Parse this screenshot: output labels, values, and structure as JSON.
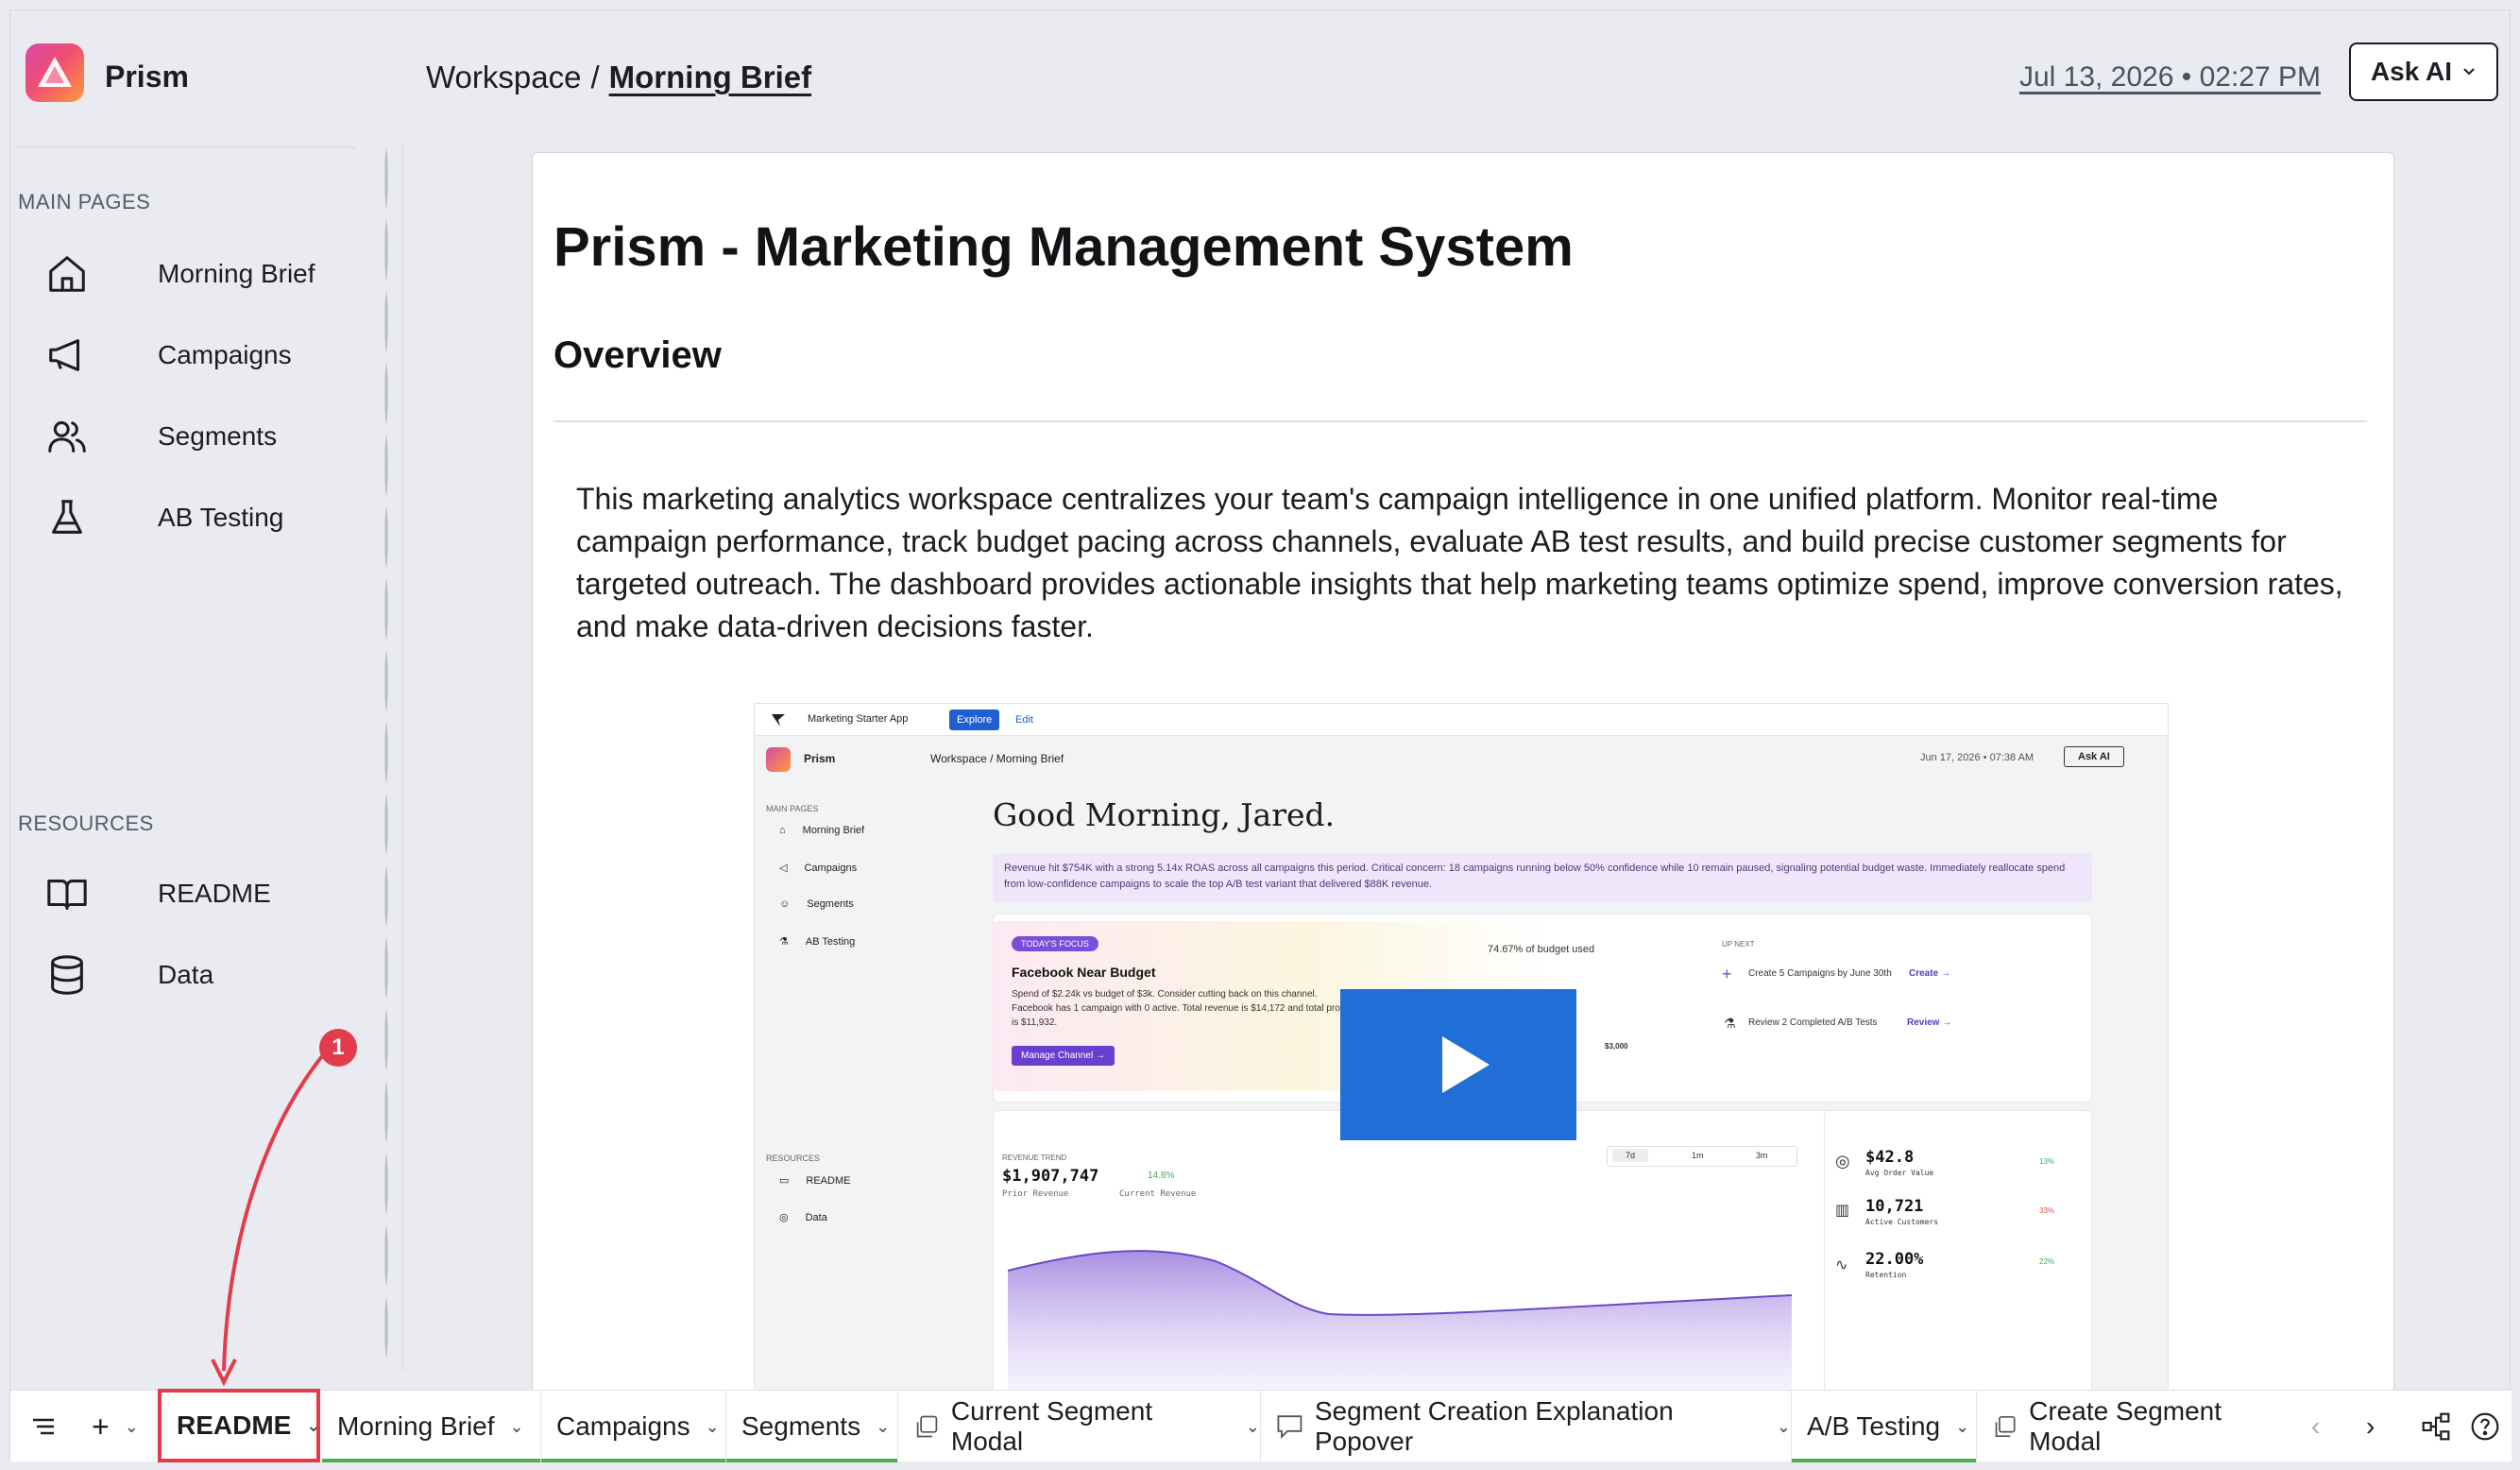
{
  "header": {
    "app_name": "Prism",
    "breadcrumb_root": "Workspace",
    "breadcrumb_sep": "/",
    "breadcrumb_current": "Morning Brief",
    "datetime": "Jul 13, 2026 • 02:27 PM",
    "ask_ai_label": "Ask AI"
  },
  "sidebar": {
    "main_label": "MAIN PAGES",
    "main_items": [
      {
        "label": "Morning Brief",
        "icon": "home-icon"
      },
      {
        "label": "Campaigns",
        "icon": "megaphone-icon"
      },
      {
        "label": "Segments",
        "icon": "users-icon"
      },
      {
        "label": "AB Testing",
        "icon": "flask-icon"
      }
    ],
    "resources_label": "RESOURCES",
    "resource_items": [
      {
        "label": "README",
        "icon": "book-icon"
      },
      {
        "label": "Data",
        "icon": "database-icon"
      }
    ]
  },
  "doc": {
    "title": "Prism - Marketing Management System",
    "overview_heading": "Overview",
    "paragraph": "This marketing analytics workspace centralizes your team's campaign intelligence in one unified platform. Monitor real-time campaign performance, track budget pacing across channels, evaluate AB test results, and build precise customer segments for targeted outreach. The dashboard provides actionable insights that help marketing teams optimize spend, improve conversion rates, and make data-driven decisions faster."
  },
  "preview": {
    "app_title": "Marketing Starter App",
    "explore": "Explore",
    "edit": "Edit",
    "app_name": "Prism",
    "breadcrumb": "Workspace / Morning Brief",
    "datetime": "Jun 17, 2026 • 07:38 AM",
    "ask_ai": "Ask AI",
    "main_pages": "MAIN PAGES",
    "nav": [
      "Morning Brief",
      "Campaigns",
      "Segments",
      "AB Testing"
    ],
    "resources": "RESOURCES",
    "res_nav": [
      "README",
      "Data"
    ],
    "greeting": "Good Morning, Jared.",
    "banner": "Revenue hit $754K with a strong 5.14x ROAS across all campaigns this period. Critical concern: 18 campaigns running below 50% confidence while 10 remain paused, signaling potential budget waste. Immediately reallocate spend from low-confidence campaigns to scale the top A/B test variant that delivered $88K revenue.",
    "focus_tag": "TODAY'S FOCUS",
    "focus_title": "Facebook Near Budget",
    "focus_body": "Spend of $2.24k vs budget of $3k. Consider cutting back on this channel. Facebook has 1 campaign with 0 active. Total revenue is $14,172 and total profit is $11,932.",
    "focus_button": "Manage Channel →",
    "budget_used": "74.67% of budget used",
    "gauge_max": "$3,000",
    "up_next": "UP NEXT",
    "next1": "Create 5 Campaigns by June 30th",
    "next1_action": "Create →",
    "next2": "Review 2 Completed A/B Tests",
    "next2_action": "Review →",
    "revenue_label": "REVENUE TREND",
    "revenue": "$1,907,747",
    "revenue_delta": "14.8%",
    "legend_prior": "Prior Revenue",
    "legend_current": "Current Revenue",
    "ranges": [
      "7d",
      "1m",
      "3m"
    ],
    "kpis": [
      {
        "value": "$42.8",
        "label": "Avg Order Value",
        "delta": "13%"
      },
      {
        "value": "10,721",
        "label": "Active Customers",
        "delta": "33%"
      },
      {
        "value": "22.00%",
        "label": "Retention",
        "delta": "22%"
      }
    ]
  },
  "tabs": [
    {
      "label": "README",
      "active": true
    },
    {
      "label": "Morning Brief"
    },
    {
      "label": "Campaigns"
    },
    {
      "label": "Segments"
    },
    {
      "label": "Current Segment Modal"
    },
    {
      "label": "Segment Creation Explanation Popover"
    },
    {
      "label": "A/B Testing"
    },
    {
      "label": "Create Segment Modal"
    }
  ],
  "annotation_number": "1",
  "colors": {
    "accent_red": "#e23c4a",
    "tab_green": "#4caf50",
    "video_blue": "#1f6fd6",
    "preview_purple": "#7a4ed8"
  }
}
